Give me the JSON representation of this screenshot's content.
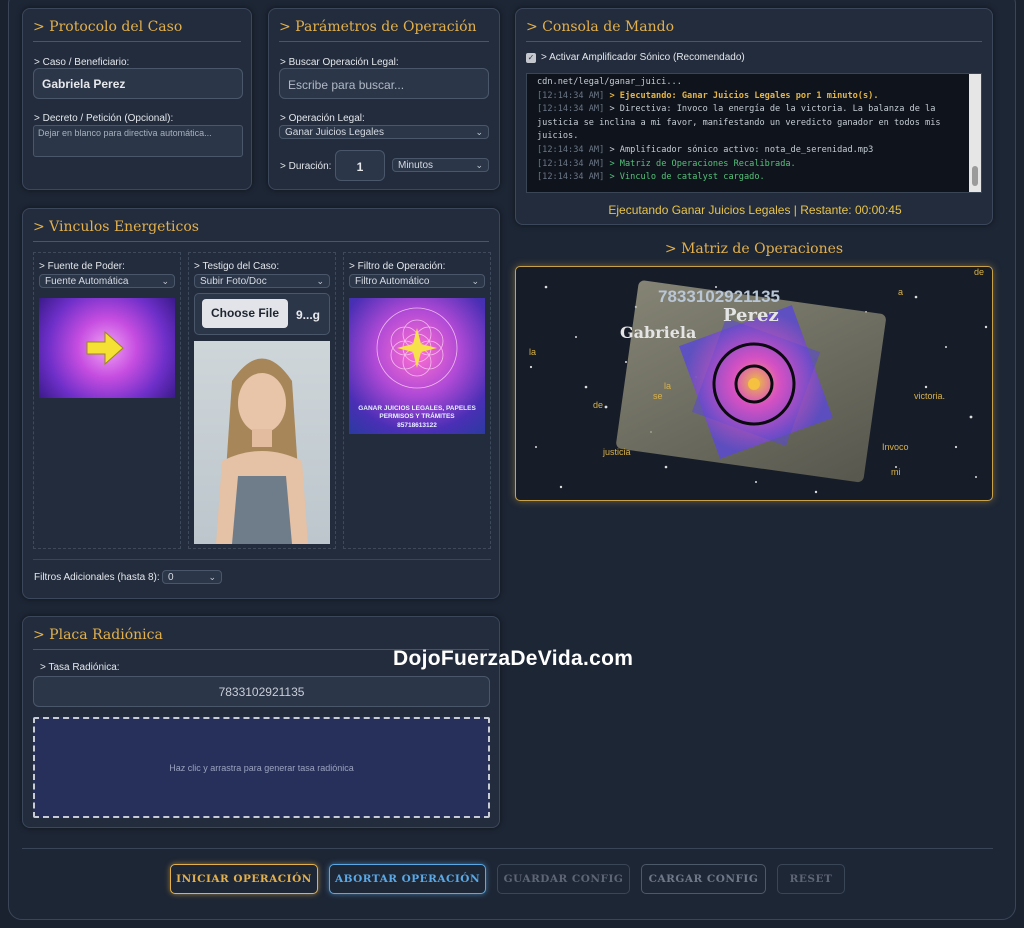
{
  "protocolo": {
    "title": "> Protocolo del Caso",
    "caso_label": "> Caso / Beneficiario:",
    "caso_value": "Gabriela Perez",
    "decreto_label": "> Decreto / Petición (Opcional):",
    "decreto_placeholder": "Dejar en blanco para directiva automática..."
  },
  "parametros": {
    "title": "> Parámetros de Operación",
    "buscar_label": "> Buscar Operación Legal:",
    "buscar_placeholder": "Escribe para buscar...",
    "operacion_label": "> Operación Legal:",
    "operacion_value": "Ganar Juicios Legales",
    "duracion_label": "> Duración:",
    "duracion_value": "1",
    "duracion_unit": "Minutos"
  },
  "consola": {
    "title": "> Consola de Mando",
    "amplificador_label": "> Activar Amplificador Sónico (Recomendado)",
    "amplificador_checked": true,
    "log": {
      "line0": "cdn.net/legal/ganar_juici...",
      "ts": "[12:14:34 AM]",
      "l1": "> Ejecutando: Ganar Juicios Legales por 1 minuto(s).",
      "l2a": "> Directiva: Invoco la energía de la victoria. La balanza de la",
      "l2b": "justicia se inclina a mi favor, manifestando un veredicto ganador en todos mis",
      "l2c": "juicios.",
      "l3": "> Amplificador sónico activo: nota_de_serenidad.mp3",
      "l4": "> Matriz de Operaciones Recalibrada.",
      "l5": "> Vinculo de catalyst cargado."
    },
    "status": "Ejecutando Ganar Juicios Legales | Restante: 00:00:45"
  },
  "matriz": {
    "title": "> Matriz de Operaciones",
    "rate": "7833102921135",
    "name_first": "Gabriela",
    "name_last": "Perez",
    "floating_words": [
      "la",
      "de",
      "justicia",
      "victoria.",
      "Invoco",
      "mi",
      "se",
      "a",
      "de",
      "la"
    ]
  },
  "vinculos": {
    "title": "> Vinculos Energeticos",
    "fuente_label": "> Fuente de Poder:",
    "fuente_value": "Fuente Automática",
    "testigo_label": "> Testigo del Caso:",
    "testigo_value": "Subir Foto/Doc",
    "choose_file": "Choose File",
    "file_name": "9...g",
    "filtro_label": "> Filtro de Operación:",
    "filtro_value": "Filtro Automático",
    "filtro_caption1": "GANAR JUICIOS LEGALES, PAPELES",
    "filtro_caption2": "PERMISOS Y TRÁMITES",
    "filtro_caption3": "85718613122",
    "adicionales_label": "Filtros Adicionales (hasta 8):",
    "adicionales_value": "0"
  },
  "placa": {
    "title": "> Placa Radiónica",
    "tasa_label": "> Tasa Radiónica:",
    "tasa_value": "7833102921135",
    "drop_hint": "Haz clic y arrastra para generar tasa radiónica"
  },
  "watermark": "DojoFuerzaDeVida.com",
  "buttons": {
    "iniciar": "INICIAR OPERACIÓN",
    "abortar": "ABORTAR OPERACIÓN",
    "guardar": "GUARDAR CONFIG",
    "cargar": "CARGAR CONFIG",
    "reset": "RESET"
  },
  "colors": {
    "accent": "#e3b04b",
    "abort": "#5aa8e6",
    "console_green": "#55c07a"
  }
}
